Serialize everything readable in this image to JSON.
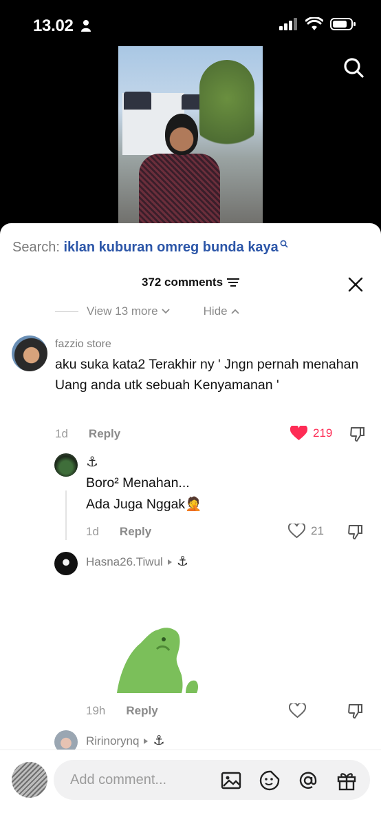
{
  "status_bar": {
    "time": "13.02"
  },
  "search": {
    "prefix": "Search:",
    "query": "iklan kuburan omreg bunda kaya"
  },
  "header": {
    "comment_count": "372 comments"
  },
  "replies_controls": {
    "view_more": "View 13 more",
    "hide": "Hide"
  },
  "comments": [
    {
      "username": "fazzio store",
      "text": "aku suka kata2 Terakhir ny ' Jngn pernah menahan Uang anda utk sebuah Kenyamanan '",
      "age": "1d",
      "reply_label": "Reply",
      "likes": "219",
      "liked": true
    },
    {
      "username": "⚓",
      "text_line1": "Boro² Menahan...",
      "text_line2": "Ada Juga Nggak🤦",
      "age": "1d",
      "reply_label": "Reply",
      "likes": "21",
      "liked": false
    },
    {
      "username": "Hasna26.Tiwul",
      "anchor": "⚓",
      "age": "19h",
      "reply_label": "Reply",
      "likes": "",
      "liked": false
    },
    {
      "username": "Ririnorynq",
      "anchor": "⚓"
    }
  ],
  "composer": {
    "placeholder": "Add comment..."
  },
  "colors": {
    "like_red": "#fe2c55",
    "search_blue": "#2c56a8"
  }
}
